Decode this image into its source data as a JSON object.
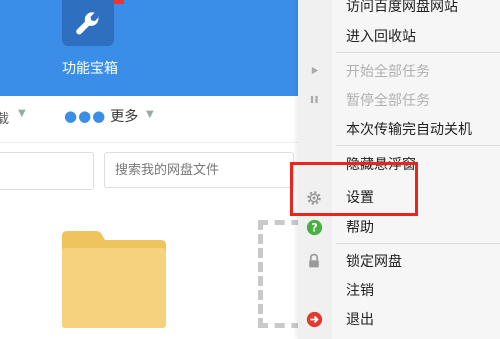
{
  "header": {
    "left_label": "",
    "tool_label": "功能宝箱"
  },
  "toolbar": {
    "left_label": "载",
    "more_label": "更多"
  },
  "search": {
    "placeholder": "搜索我的网盘文件"
  },
  "menu": {
    "items": [
      {
        "label": "访问百度网盘网站",
        "enabled": true
      },
      {
        "label": "进入回收站",
        "enabled": true
      },
      {
        "label": "开始全部任务",
        "enabled": false
      },
      {
        "label": "暂停全部任务",
        "enabled": false
      },
      {
        "label": "本次传输完自动关机",
        "enabled": true
      },
      {
        "label": "隐藏悬浮窗",
        "enabled": true
      },
      {
        "label": "设置",
        "enabled": true
      },
      {
        "label": "帮助",
        "enabled": true
      },
      {
        "label": "锁定网盘",
        "enabled": true
      },
      {
        "label": "注销",
        "enabled": true
      },
      {
        "label": "退出",
        "enabled": true
      }
    ]
  },
  "colors": {
    "header_blue": "#3b8ee8",
    "highlight_red": "#e8261e",
    "folder_yellow": "#f6d27e"
  }
}
